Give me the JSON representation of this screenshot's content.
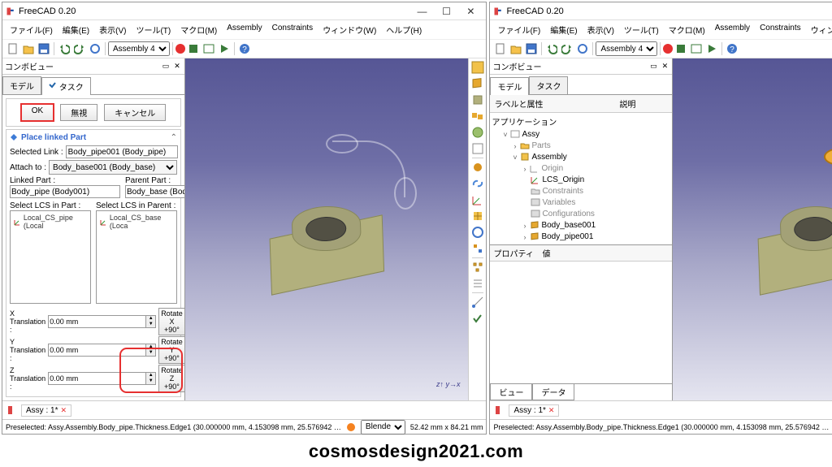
{
  "app_title": "FreeCAD 0.20",
  "win_controls": {
    "min": "—",
    "max": "☐",
    "close": "✕"
  },
  "menus": [
    "ファイル(F)",
    "編集(E)",
    "表示(V)",
    "ツール(T)",
    "マクロ(M)",
    "Assembly",
    "Constraints",
    "ウィンドウ(W)",
    "ヘルプ(H)"
  ],
  "wb_combo": "Assembly 4",
  "combo_title": "コンボビュー",
  "left": {
    "tabs": {
      "model": "モデル",
      "task": "タスク"
    },
    "buttons": {
      "ok": "OK",
      "cancel": "無視",
      "close": "キャンセル"
    },
    "panel_title": "Place linked Part",
    "selected_link_label": "Selected Link :",
    "selected_link_value": "Body_pipe001 (Body_pipe)",
    "attach_label": "Attach to :",
    "attach_value": "Body_base001 (Body_base)",
    "linked_part_label": "Linked Part :",
    "linked_part_value": "Body_pipe (Body001)",
    "parent_part_label": "Parent Part :",
    "parent_part_value": "Body_base (Body)",
    "select_lcs_part_label": "Select LCS in Part :",
    "select_lcs_parent_label": "Select LCS in Parent :",
    "lcs_part_item": "Local_CS_pipe (Local",
    "lcs_parent_item": "Local_CS_base (Loca",
    "xtrans_label": "X Translation :",
    "ytrans_label": "Y Translation :",
    "ztrans_label": "Z Translation :",
    "trans_value": "0.00 mm",
    "rotx": "Rotate X +90°",
    "roty": "Rotate Y +90°",
    "rotz": "Rotate Z +90°"
  },
  "right": {
    "tabs": {
      "model": "モデル",
      "task": "タスク"
    },
    "labels_col": "ラベルと属性",
    "desc_col": "説明",
    "tree": {
      "app": "アプリケーション",
      "assy": "Assy",
      "parts": "Parts",
      "assembly": "Assembly",
      "origin": "Origin",
      "lcs": "LCS_Origin",
      "constraints": "Constraints",
      "variables": "Variables",
      "configs": "Configurations",
      "base": "Body_base001",
      "pipe": "Body_pipe001"
    },
    "prop_col": "プロパティ",
    "val_col": "値",
    "bottom_tabs": {
      "view": "ビュー",
      "data": "データ"
    }
  },
  "doc_tab": "Assy : 1*",
  "doc_tab_close": "✕",
  "status": {
    "preselected": "Preselected: Assy.Assembly.Body_pipe.Thickness.Edge1 (30.000000 mm, 4.153098 mm, 25.576942 …",
    "blender_label": "Blender",
    "dims": "52.42 mm x 84.21 mm"
  },
  "watermark": "cosmosdesign2021.com",
  "axis": "z↑ y→x"
}
